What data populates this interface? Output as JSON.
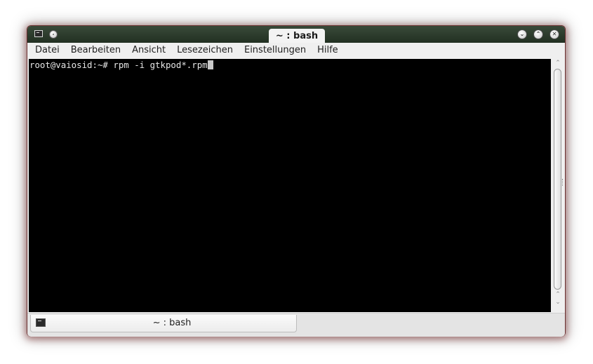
{
  "window": {
    "title": "~ : bash",
    "buttons": {
      "minimize": "⌄",
      "maximize": "⌃",
      "close": "✕"
    }
  },
  "menu": [
    "Datei",
    "Bearbeiten",
    "Ansicht",
    "Lesezeichen",
    "Einstellungen",
    "Hilfe"
  ],
  "terminal": {
    "prompt": "root@vaiosid:~# ",
    "command": "rpm -i gtkpod*.rpm"
  },
  "tabs": [
    {
      "label": "~ : bash"
    }
  ],
  "icons": {
    "app": "terminal-icon",
    "window_menu": "window-menu-icon",
    "tab": "terminal-tab-icon"
  },
  "colors": {
    "terminal_bg": "#000000",
    "terminal_fg": "#e6e6e6",
    "titlebar": "#2a382a"
  }
}
